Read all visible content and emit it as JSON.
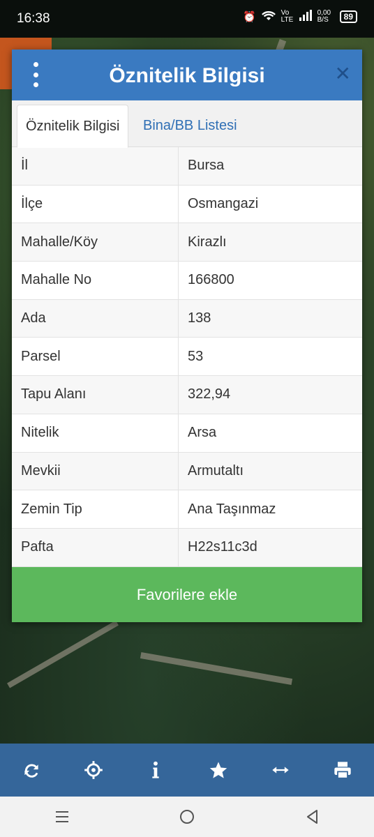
{
  "status_bar": {
    "time": "16:38",
    "network": "Vo LTE",
    "speed": "0,00 B/S",
    "battery": "89"
  },
  "dialog": {
    "title": "Öznitelik Bilgisi",
    "tabs": [
      {
        "label": "Öznitelik Bilgisi",
        "active": true
      },
      {
        "label": "Bina/BB Listesi",
        "active": false
      }
    ],
    "rows": [
      {
        "key": "İl",
        "value": "Bursa"
      },
      {
        "key": "İlçe",
        "value": "Osmangazi"
      },
      {
        "key": "Mahalle/Köy",
        "value": "Kirazlı"
      },
      {
        "key": "Mahalle No",
        "value": "166800"
      },
      {
        "key": "Ada",
        "value": "138"
      },
      {
        "key": "Parsel",
        "value": "53"
      },
      {
        "key": "Tapu Alanı",
        "value": "322,94"
      },
      {
        "key": "Nitelik",
        "value": "Arsa"
      },
      {
        "key": "Mevkii",
        "value": "Armutaltı"
      },
      {
        "key": "Zemin Tip",
        "value": "Ana Taşınmaz"
      },
      {
        "key": "Pafta",
        "value": "H22s11c3d"
      }
    ],
    "favorite_button": "Favorilere ekle"
  },
  "toolbar": {
    "items": [
      "refresh-icon",
      "locate-icon",
      "info-icon",
      "star-icon",
      "measure-icon",
      "print-icon"
    ]
  },
  "colors": {
    "header": "#3a7ac1",
    "button": "#5cb85c",
    "toolbar": "#35669a"
  }
}
